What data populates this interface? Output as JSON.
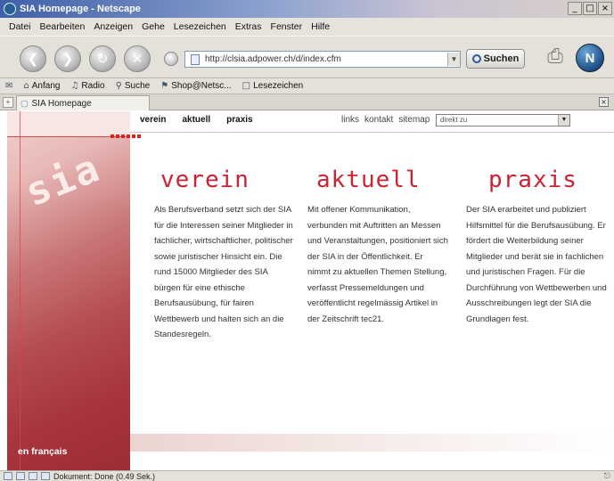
{
  "window": {
    "title": "SIA Homepage - Netscape",
    "controls": [
      "_",
      "□",
      "×"
    ]
  },
  "menu": [
    "Datei",
    "Bearbeiten",
    "Anzeigen",
    "Gehe",
    "Lesezeichen",
    "Extras",
    "Fenster",
    "Hilfe"
  ],
  "nav": {
    "back_icon": "back-arrow-icon",
    "url": "http://clsia.adpower.ch/d/index.cfm",
    "search_label": "Suchen"
  },
  "personal_toolbar": [
    "Anfang",
    "Radio",
    "Suche",
    "Shop@Netsc...",
    "Lesezeichen"
  ],
  "tab": {
    "title": "SIA Homepage"
  },
  "site": {
    "logo_text": "sia",
    "top_nav": [
      "verein",
      "aktuell",
      "praxis"
    ],
    "util_nav": [
      "links",
      "kontakt",
      "sitemap"
    ],
    "jump_placeholder": "direkt zu",
    "language_link": "en français",
    "columns": [
      {
        "heading": "verein",
        "text": "Als Berufsverband setzt sich der SIA für die Interessen seiner Mitglieder in fachlicher, wirtschaftlicher, politischer sowie juristischer Hinsicht ein. Die rund 15000 Mitglieder des SIA bürgen für eine ethische Berufsausübung, für fairen Wettbewerb und halten sich an die Standesregeln."
      },
      {
        "heading": "aktuell",
        "text": "Mit offener Kommunikation, verbunden mit Auftritten an Messen und Veranstaltungen, positioniert sich der SIA in der Öffentlichkeit. Er nimmt zu aktuellen Themen Stellung, verfasst Pressemeldungen und veröffentlicht regelmässig Artikel in der Zeitschrift tec21."
      },
      {
        "heading": "praxis",
        "text": "Der SIA erarbeitet und publiziert Hilfsmittel für die Berufsausübung. Er fördert die Weiterbildung seiner Mitglieder und berät sie in fachlichen und juristischen Fragen. Für die Durchführung von Wettbewerben und Ausschreibungen legt der SIA die Grundlagen fest."
      }
    ]
  },
  "status": {
    "text": "Dokument: Done (0.49 Sek.)"
  },
  "colors": {
    "accent": "#cc2233",
    "sidebar": "#b44d52"
  }
}
